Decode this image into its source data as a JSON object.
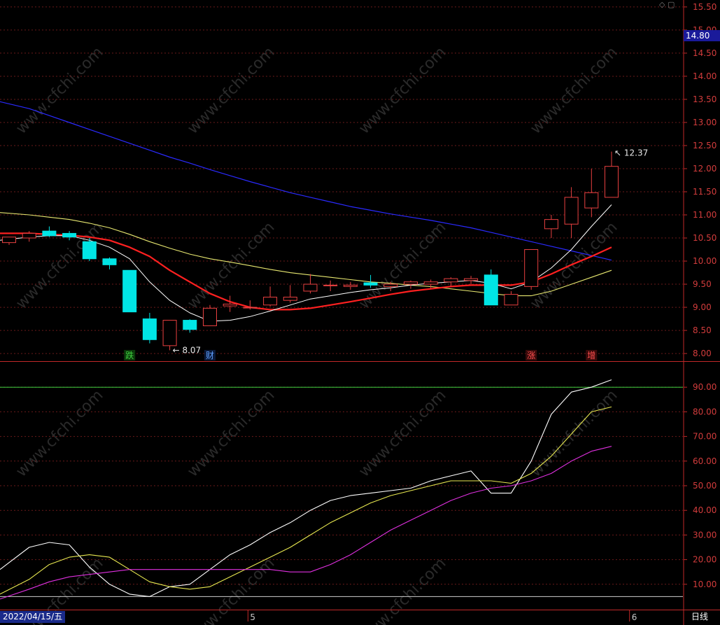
{
  "current_price_label": "14.80",
  "date_label": "2022/04/15/五",
  "period_label": "日线",
  "watermark_text": "www.cfchi.com",
  "top_icons": "◇ ▢",
  "colors": {
    "up": "#e84040",
    "down": "#00e5e5",
    "ma5": "#ffffff",
    "ma10": "#ff2020",
    "ma20": "#e8e870",
    "ma60": "#2a2aff",
    "k_line": "#ffffff",
    "d_line": "#e8e850",
    "j_line": "#e030e0",
    "axis": "#c02828",
    "grid": "#6a1a1a",
    "overbought": "#40d040",
    "oversold": "#d0d0d0"
  },
  "chart_data": [
    {
      "type": "candlestick",
      "ylim": [
        7.85,
        15.65
      ],
      "yticks": [
        "8.00",
        "8.50",
        "9.00",
        "9.50",
        "10.00",
        "10.50",
        "11.00",
        "11.50",
        "12.00",
        "12.50",
        "13.00",
        "13.50",
        "14.00",
        "14.50",
        "15.00",
        "15.50"
      ],
      "ytick_values": [
        8.0,
        8.5,
        9.0,
        9.5,
        10.0,
        10.5,
        11.0,
        11.5,
        12.0,
        12.5,
        13.0,
        13.5,
        14.0,
        14.5,
        15.0,
        15.5
      ],
      "x_tick_labels": [
        "5",
        "6"
      ],
      "x_tick_index": [
        12,
        31
      ],
      "candles": [
        {
          "o": 10.4,
          "h": 10.52,
          "l": 10.35,
          "c": 10.52
        },
        {
          "o": 10.5,
          "h": 10.65,
          "l": 10.42,
          "c": 10.6
        },
        {
          "o": 10.65,
          "h": 10.75,
          "l": 10.52,
          "c": 10.55
        },
        {
          "o": 10.6,
          "h": 10.65,
          "l": 10.45,
          "c": 10.52
        },
        {
          "o": 10.42,
          "h": 10.5,
          "l": 10.0,
          "c": 10.05
        },
        {
          "o": 10.05,
          "h": 10.08,
          "l": 9.82,
          "c": 9.92
        },
        {
          "o": 9.8,
          "h": 9.8,
          "l": 8.9,
          "c": 8.9
        },
        {
          "o": 8.75,
          "h": 8.88,
          "l": 8.22,
          "c": 8.3
        },
        {
          "o": 8.17,
          "h": 8.72,
          "l": 8.07,
          "c": 8.72
        },
        {
          "o": 8.72,
          "h": 8.74,
          "l": 8.45,
          "c": 8.52
        },
        {
          "o": 8.6,
          "h": 9.05,
          "l": 8.6,
          "c": 8.98
        },
        {
          "o": 9.03,
          "h": 9.25,
          "l": 8.9,
          "c": 9.07
        },
        {
          "o": 9.0,
          "h": 9.15,
          "l": 8.95,
          "c": 9.0
        },
        {
          "o": 9.05,
          "h": 9.45,
          "l": 9.02,
          "c": 9.22
        },
        {
          "o": 9.15,
          "h": 9.48,
          "l": 9.1,
          "c": 9.22
        },
        {
          "o": 9.35,
          "h": 9.72,
          "l": 9.3,
          "c": 9.5
        },
        {
          "o": 9.48,
          "h": 9.58,
          "l": 9.35,
          "c": 9.48
        },
        {
          "o": 9.45,
          "h": 9.55,
          "l": 9.38,
          "c": 9.48
        },
        {
          "o": 9.53,
          "h": 9.7,
          "l": 9.42,
          "c": 9.48
        },
        {
          "o": 9.45,
          "h": 9.55,
          "l": 9.35,
          "c": 9.5
        },
        {
          "o": 9.5,
          "h": 9.58,
          "l": 9.4,
          "c": 9.55
        },
        {
          "o": 9.5,
          "h": 9.6,
          "l": 9.4,
          "c": 9.55
        },
        {
          "o": 9.55,
          "h": 9.65,
          "l": 9.45,
          "c": 9.62
        },
        {
          "o": 9.58,
          "h": 9.68,
          "l": 9.5,
          "c": 9.62
        },
        {
          "o": 9.7,
          "h": 9.82,
          "l": 9.05,
          "c": 9.05
        },
        {
          "o": 9.05,
          "h": 9.35,
          "l": 9.05,
          "c": 9.28
        },
        {
          "o": 9.45,
          "h": 10.25,
          "l": 9.38,
          "c": 10.25
        },
        {
          "o": 10.7,
          "h": 11.0,
          "l": 10.5,
          "c": 10.9
        },
        {
          "o": 10.8,
          "h": 11.6,
          "l": 10.5,
          "c": 11.38
        },
        {
          "o": 11.15,
          "h": 12.0,
          "l": 10.95,
          "c": 11.48
        },
        {
          "o": 11.38,
          "h": 12.37,
          "l": 11.38,
          "c": 12.05
        }
      ],
      "ma5": [
        10.45,
        10.52,
        10.55,
        10.55,
        10.45,
        10.3,
        10.05,
        9.55,
        9.15,
        8.88,
        8.7,
        8.72,
        8.8,
        8.92,
        9.05,
        9.18,
        9.25,
        9.32,
        9.38,
        9.42,
        9.48,
        9.52,
        9.55,
        9.58,
        9.52,
        9.4,
        9.55,
        9.85,
        10.25,
        10.75,
        11.22
      ],
      "ma10": [
        10.6,
        10.6,
        10.58,
        10.56,
        10.52,
        10.45,
        10.3,
        10.1,
        9.8,
        9.55,
        9.3,
        9.12,
        9.0,
        8.95,
        8.95,
        8.98,
        9.05,
        9.12,
        9.2,
        9.28,
        9.35,
        9.4,
        9.45,
        9.48,
        9.48,
        9.48,
        9.55,
        9.72,
        9.92,
        10.1,
        10.3
      ],
      "ma20": [
        11.05,
        11.0,
        10.95,
        10.9,
        10.82,
        10.72,
        10.58,
        10.42,
        10.28,
        10.15,
        10.05,
        9.98,
        9.9,
        9.82,
        9.75,
        9.7,
        9.65,
        9.6,
        9.55,
        9.52,
        9.48,
        9.45,
        9.4,
        9.35,
        9.3,
        9.25,
        9.25,
        9.35,
        9.5,
        9.65,
        9.8
      ],
      "ma60": [
        13.45,
        13.3,
        13.15,
        13.0,
        12.85,
        12.7,
        12.55,
        12.4,
        12.25,
        12.12,
        11.98,
        11.85,
        11.72,
        11.6,
        11.48,
        11.38,
        11.28,
        11.18,
        11.1,
        11.02,
        10.95,
        10.88,
        10.8,
        10.72,
        10.62,
        10.52,
        10.42,
        10.32,
        10.22,
        10.12,
        10.02
      ],
      "annotations": [
        {
          "text": "12.37",
          "index": 30
        },
        {
          "text": "8.07",
          "index": 8
        }
      ],
      "badges": [
        {
          "text": "跌",
          "index": 6,
          "color": "#40d040",
          "bg": "#0a3a0a"
        },
        {
          "text": "财",
          "index": 10,
          "color": "#60a0ff",
          "bg": "#0a1a3a"
        },
        {
          "text": "涨",
          "index": 26,
          "color": "#ff5050",
          "bg": "#3a0a0a"
        },
        {
          "text": "增",
          "index": 29,
          "color": "#ff5050",
          "bg": "#3a0a0a"
        }
      ]
    },
    {
      "type": "line",
      "ylim": [
        0,
        100
      ],
      "yticks": [
        "10.00",
        "20.00",
        "30.00",
        "40.00",
        "50.00",
        "60.00",
        "70.00",
        "80.00",
        "90.00"
      ],
      "ytick_values": [
        10,
        20,
        30,
        40,
        50,
        60,
        70,
        80,
        90
      ],
      "reference_lines": [
        {
          "value": 90,
          "color": "#40d040"
        },
        {
          "value": 5,
          "color": "#d0d0d0"
        }
      ],
      "series": [
        {
          "values": [
            16,
            25,
            27,
            26,
            17,
            10,
            6,
            5,
            9,
            10,
            16,
            22,
            26,
            31,
            35,
            40,
            44,
            46,
            47,
            48,
            49,
            52,
            54,
            56,
            47,
            47,
            60,
            79,
            88,
            90,
            93
          ]
        },
        {
          "values": [
            6,
            12,
            18,
            21,
            22,
            21,
            16,
            11,
            9,
            8,
            9,
            13,
            17,
            21,
            25,
            30,
            35,
            39,
            43,
            46,
            48,
            50,
            52,
            52,
            52,
            51,
            55,
            62,
            71,
            80,
            82
          ]
        },
        {
          "values": [
            4,
            8,
            11,
            13,
            14,
            15,
            16,
            16,
            16,
            16,
            16,
            16,
            16,
            16,
            15,
            15,
            18,
            22,
            27,
            32,
            36,
            40,
            44,
            47,
            49,
            50,
            52,
            55,
            60,
            64,
            66
          ]
        }
      ]
    }
  ]
}
